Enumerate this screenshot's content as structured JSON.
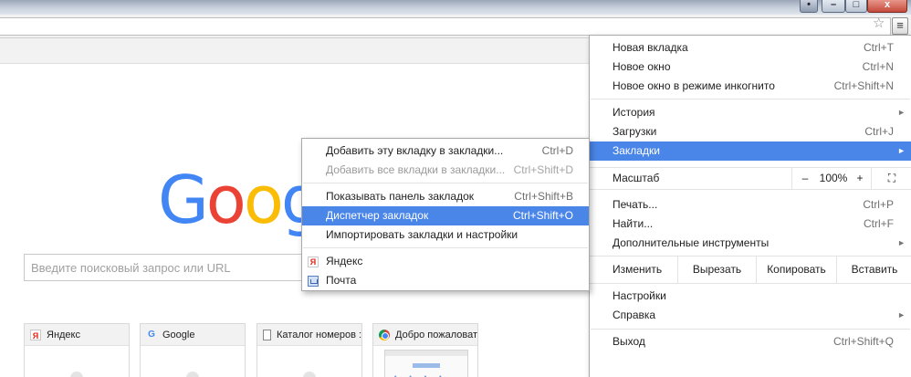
{
  "window": {
    "menu_glyph": "≡",
    "min_glyph": "–",
    "max_glyph": "□",
    "close_glyph": "x"
  },
  "toolbar": {
    "star_glyph": "☆"
  },
  "page": {
    "logo": {
      "text": [
        "G",
        "o",
        "o",
        "g"
      ],
      "colors": [
        "#4285f4",
        "#ea4335",
        "#fbbc05",
        "#4285f4"
      ]
    },
    "search_placeholder": "Введите поисковый запрос или URL",
    "tiles": [
      {
        "title": "Яндекс",
        "icon": "yandex-icon"
      },
      {
        "title": "Google",
        "icon": "google-icon"
      },
      {
        "title": "Каталог номеров : К",
        "icon": "document-icon"
      },
      {
        "title": "Добро пожаловать в",
        "icon": "chrome-icon"
      }
    ]
  },
  "main_menu": {
    "new_tab": {
      "label": "Новая вкладка",
      "shortcut": "Ctrl+T"
    },
    "new_window": {
      "label": "Новое окно",
      "shortcut": "Ctrl+N"
    },
    "incognito": {
      "label": "Новое окно в режиме инкогнито",
      "shortcut": "Ctrl+Shift+N"
    },
    "history": {
      "label": "История"
    },
    "downloads": {
      "label": "Загрузки",
      "shortcut": "Ctrl+J"
    },
    "bookmarks": {
      "label": "Закладки"
    },
    "zoom": {
      "label": "Масштаб",
      "minus": "–",
      "value": "100%",
      "plus": "+",
      "fullscreen": "⛶"
    },
    "print": {
      "label": "Печать...",
      "shortcut": "Ctrl+P"
    },
    "find": {
      "label": "Найти...",
      "shortcut": "Ctrl+F"
    },
    "more_tools": {
      "label": "Дополнительные инструменты"
    },
    "edit": {
      "label": "Изменить",
      "cut": "Вырезать",
      "copy": "Копировать",
      "paste": "Вставить"
    },
    "settings": {
      "label": "Настройки"
    },
    "help": {
      "label": "Справка"
    },
    "exit": {
      "label": "Выход",
      "shortcut": "Ctrl+Shift+Q"
    },
    "arrow": "►"
  },
  "bookmarks_submenu": {
    "add_tab": {
      "label": "Добавить эту вкладку в закладки...",
      "shortcut": "Ctrl+D"
    },
    "add_all": {
      "label": "Добавить все вкладки в закладки...",
      "shortcut": "Ctrl+Shift+D"
    },
    "show_bar": {
      "label": "Показывать панель закладок",
      "shortcut": "Ctrl+Shift+B"
    },
    "manager": {
      "label": "Диспетчер закладок",
      "shortcut": "Ctrl+Shift+O"
    },
    "import": {
      "label": "Импортировать закладки и настройки"
    },
    "yandex": {
      "label": "Яндекс",
      "icon_glyph": "Я"
    },
    "mail": {
      "label": "Почта"
    }
  },
  "colors": {
    "highlight": "#4a85e8"
  }
}
